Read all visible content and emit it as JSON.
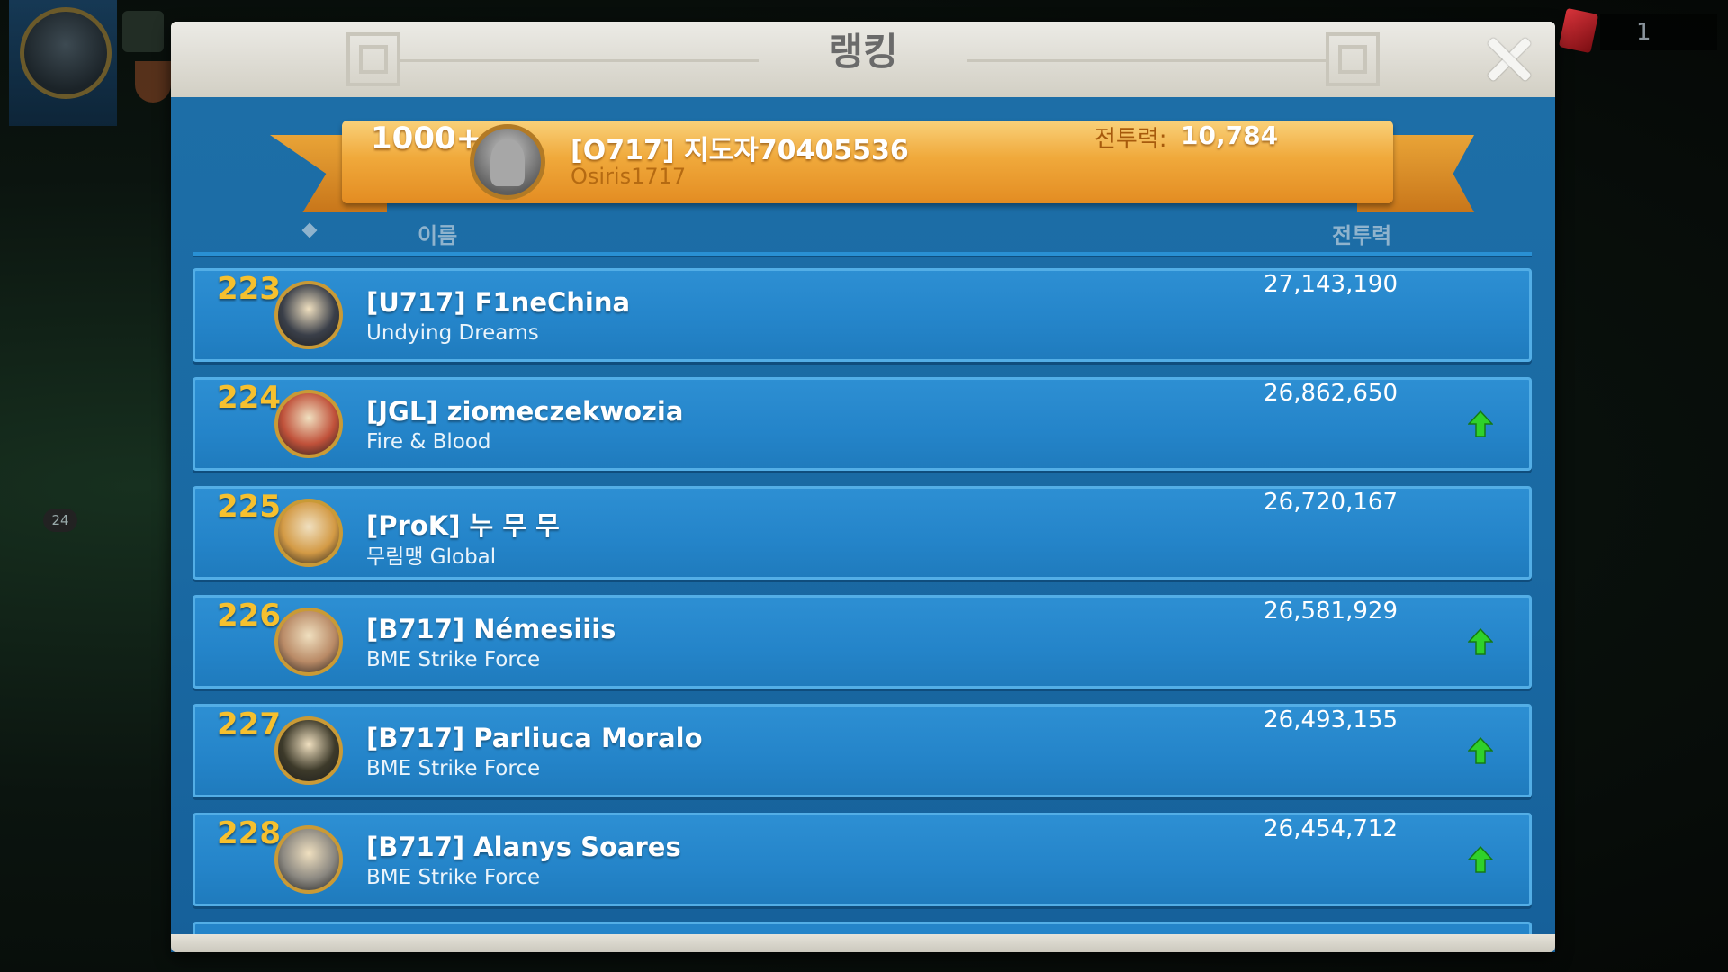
{
  "background": {
    "level_badge": "24",
    "resource_count": "1"
  },
  "panel": {
    "title": "랭킹"
  },
  "my_rank": {
    "rank": "1000+",
    "name": "[O717] 지도자70405536",
    "alliance": "Osiris1717",
    "power_label": "전투력:",
    "power_value": "10,784"
  },
  "columns": {
    "name": "이름",
    "power": "전투력"
  },
  "rows": [
    {
      "rank": "223",
      "name": "[U717] F1neChina",
      "alliance": "Undying Dreams",
      "power": "27,143,190",
      "trend": "none",
      "avatar_color": "#3a3f49"
    },
    {
      "rank": "224",
      "name": "[JGL] ziomeczekwozia",
      "alliance": "Fire & Blood",
      "power": "26,862,650",
      "trend": "up",
      "avatar_color": "#c0513a"
    },
    {
      "rank": "225",
      "name": "[ProK] 누 무 무",
      "alliance": "무림맹 Global",
      "power": "26,720,167",
      "trend": "none",
      "avatar_color": "#d39a45"
    },
    {
      "rank": "226",
      "name": "[B717] Némesiiis",
      "alliance": "BME Strike Force",
      "power": "26,581,929",
      "trend": "up",
      "avatar_color": "#b98a66"
    },
    {
      "rank": "227",
      "name": "[B717] Parliuca Moralo",
      "alliance": "BME Strike Force",
      "power": "26,493,155",
      "trend": "up",
      "avatar_color": "#3d3a2a"
    },
    {
      "rank": "228",
      "name": "[B717] Alanys Soares",
      "alliance": "BME Strike Force",
      "power": "26,454,712",
      "trend": "up",
      "avatar_color": "#8a8780"
    }
  ],
  "colors": {
    "rank_gold": "#f6c02e",
    "trend_up": "#2fd12a",
    "row_blue": "#2484c9"
  }
}
